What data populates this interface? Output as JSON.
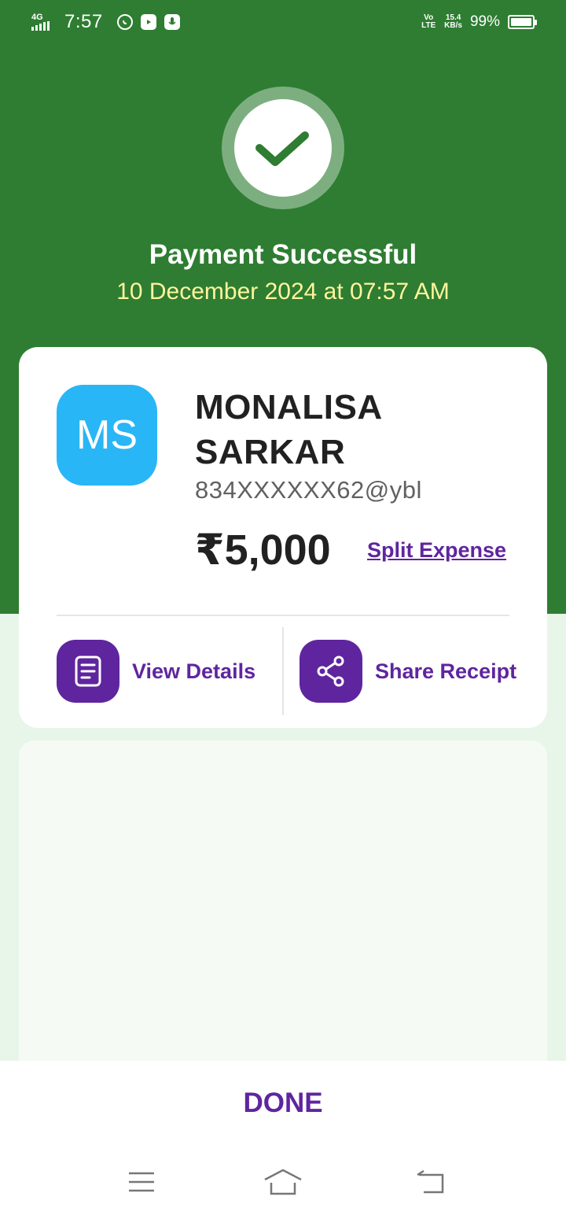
{
  "status_bar": {
    "network": "4G",
    "time": "7:57",
    "volte": "Vo LTE",
    "speed_value": "15.4",
    "speed_unit": "KB/s",
    "battery": "99%",
    "battery_level": 0.99
  },
  "header": {
    "title": "Payment Successful",
    "datetime": "10 December 2024 at 07:57 AM"
  },
  "payee": {
    "initials": "MS",
    "name": "MONALISA SARKAR",
    "upi": "834XXXXXX62@ybl",
    "amount": "₹5,000",
    "split_label": "Split Expense"
  },
  "actions": {
    "view_details": "View Details",
    "share_receipt": "Share Receipt"
  },
  "footer": {
    "done_label": "DONE"
  },
  "colors": {
    "header_green": "#2e7d32",
    "brand_purple": "#5f259f",
    "avatar_blue": "#29b6f6",
    "date_yellow": "#fff59d"
  }
}
